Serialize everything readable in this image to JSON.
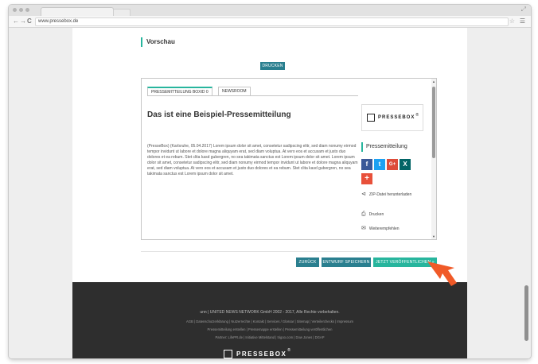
{
  "browser": {
    "url": "www.pressebox.de",
    "nav": {
      "back": "←",
      "forward": "→",
      "reload": "C"
    }
  },
  "page": {
    "preview_title": "Vorschau",
    "print_button": "DRUCKEN",
    "preview": {
      "tabs": [
        {
          "label": "PRESSEMITTEILUNG BOXID 0",
          "active": true
        },
        {
          "label": "NEWSROOM",
          "active": false
        }
      ],
      "title": "Das ist eine Beispiel-Pressemitteilung",
      "body": "(PresseBox) (Karlsruhe, 05.04.2017) Lorem ipsum dolor sit amet, consetetur sadipscing elitr, sed diam nonumy eirmod tempor invidunt ut labore et dolore magna aliquyam erat, sed diam voluptua. At vero eos et accusam et justo duo dolores et ea rebum. Stet clita kasd gubergren, no sea takimata sanctus est Lorem ipsum dolor sit amet. Lorem ipsum dolor sit amet, consetetur sadipscing elitr, sed diam nonumy eirmod tempor invidunt ut labore et dolore magna aliquyam erat, sed diam voluptua. At vero eos et accusam et justo duo dolores et ea rebum. Stet clita kasd gubergren, no sea takimata sanctus est Lorem ipsum dolor sit amet.",
      "logo_text": "PRESSEBOX",
      "logo_reg": "®",
      "sidebar_heading": "Pressemitteilung",
      "social": [
        {
          "name": "facebook-icon",
          "glyph": "f",
          "color": "#3b5998"
        },
        {
          "name": "twitter-icon",
          "glyph": "t",
          "color": "#1da1f2"
        },
        {
          "name": "google-plus-icon",
          "glyph": "G+",
          "color": "#dd4b39"
        },
        {
          "name": "xing-icon",
          "glyph": "X",
          "color": "#026466"
        },
        {
          "name": "more-share-icon",
          "glyph": "+",
          "color": "#e8503a"
        }
      ],
      "links": {
        "zip": "ZIP-Datei herunterladen",
        "print": "Drucken",
        "recommend": "Weiterempfehlen"
      }
    },
    "actions": {
      "back": "ZURÜCK",
      "save_draft": "ENTWURF SPEICHERN",
      "publish": "JETZT VERÖFFENTLICHEN »"
    },
    "footer": {
      "copyright": "unn | UNITED NEWS NETWORK GmbH 2002 - 2017, Alle Rechte vorbehalten.",
      "links_line1": "AGB | Datenschutzerklärung | Nutzerrechte | Kontakt | Services / Glossar | Sitemap | Verteilerchecks | Impressum",
      "links_line2": "Pressemitteilung erstellen | Pressemappe erstellen | Pressemitteilung veröffentlichen",
      "partners": "Partner: LifePR.de | Initiative Mittelstand | trigoo.com | Dow Jones | DGAP",
      "logo_text": "PRESSEBOX",
      "logo_reg": "®"
    }
  },
  "colors": {
    "accent": "#27b59d",
    "button_dark": "#2a7f8f",
    "footer_bg": "#2e2e2e",
    "cursor": "#f05a28"
  }
}
